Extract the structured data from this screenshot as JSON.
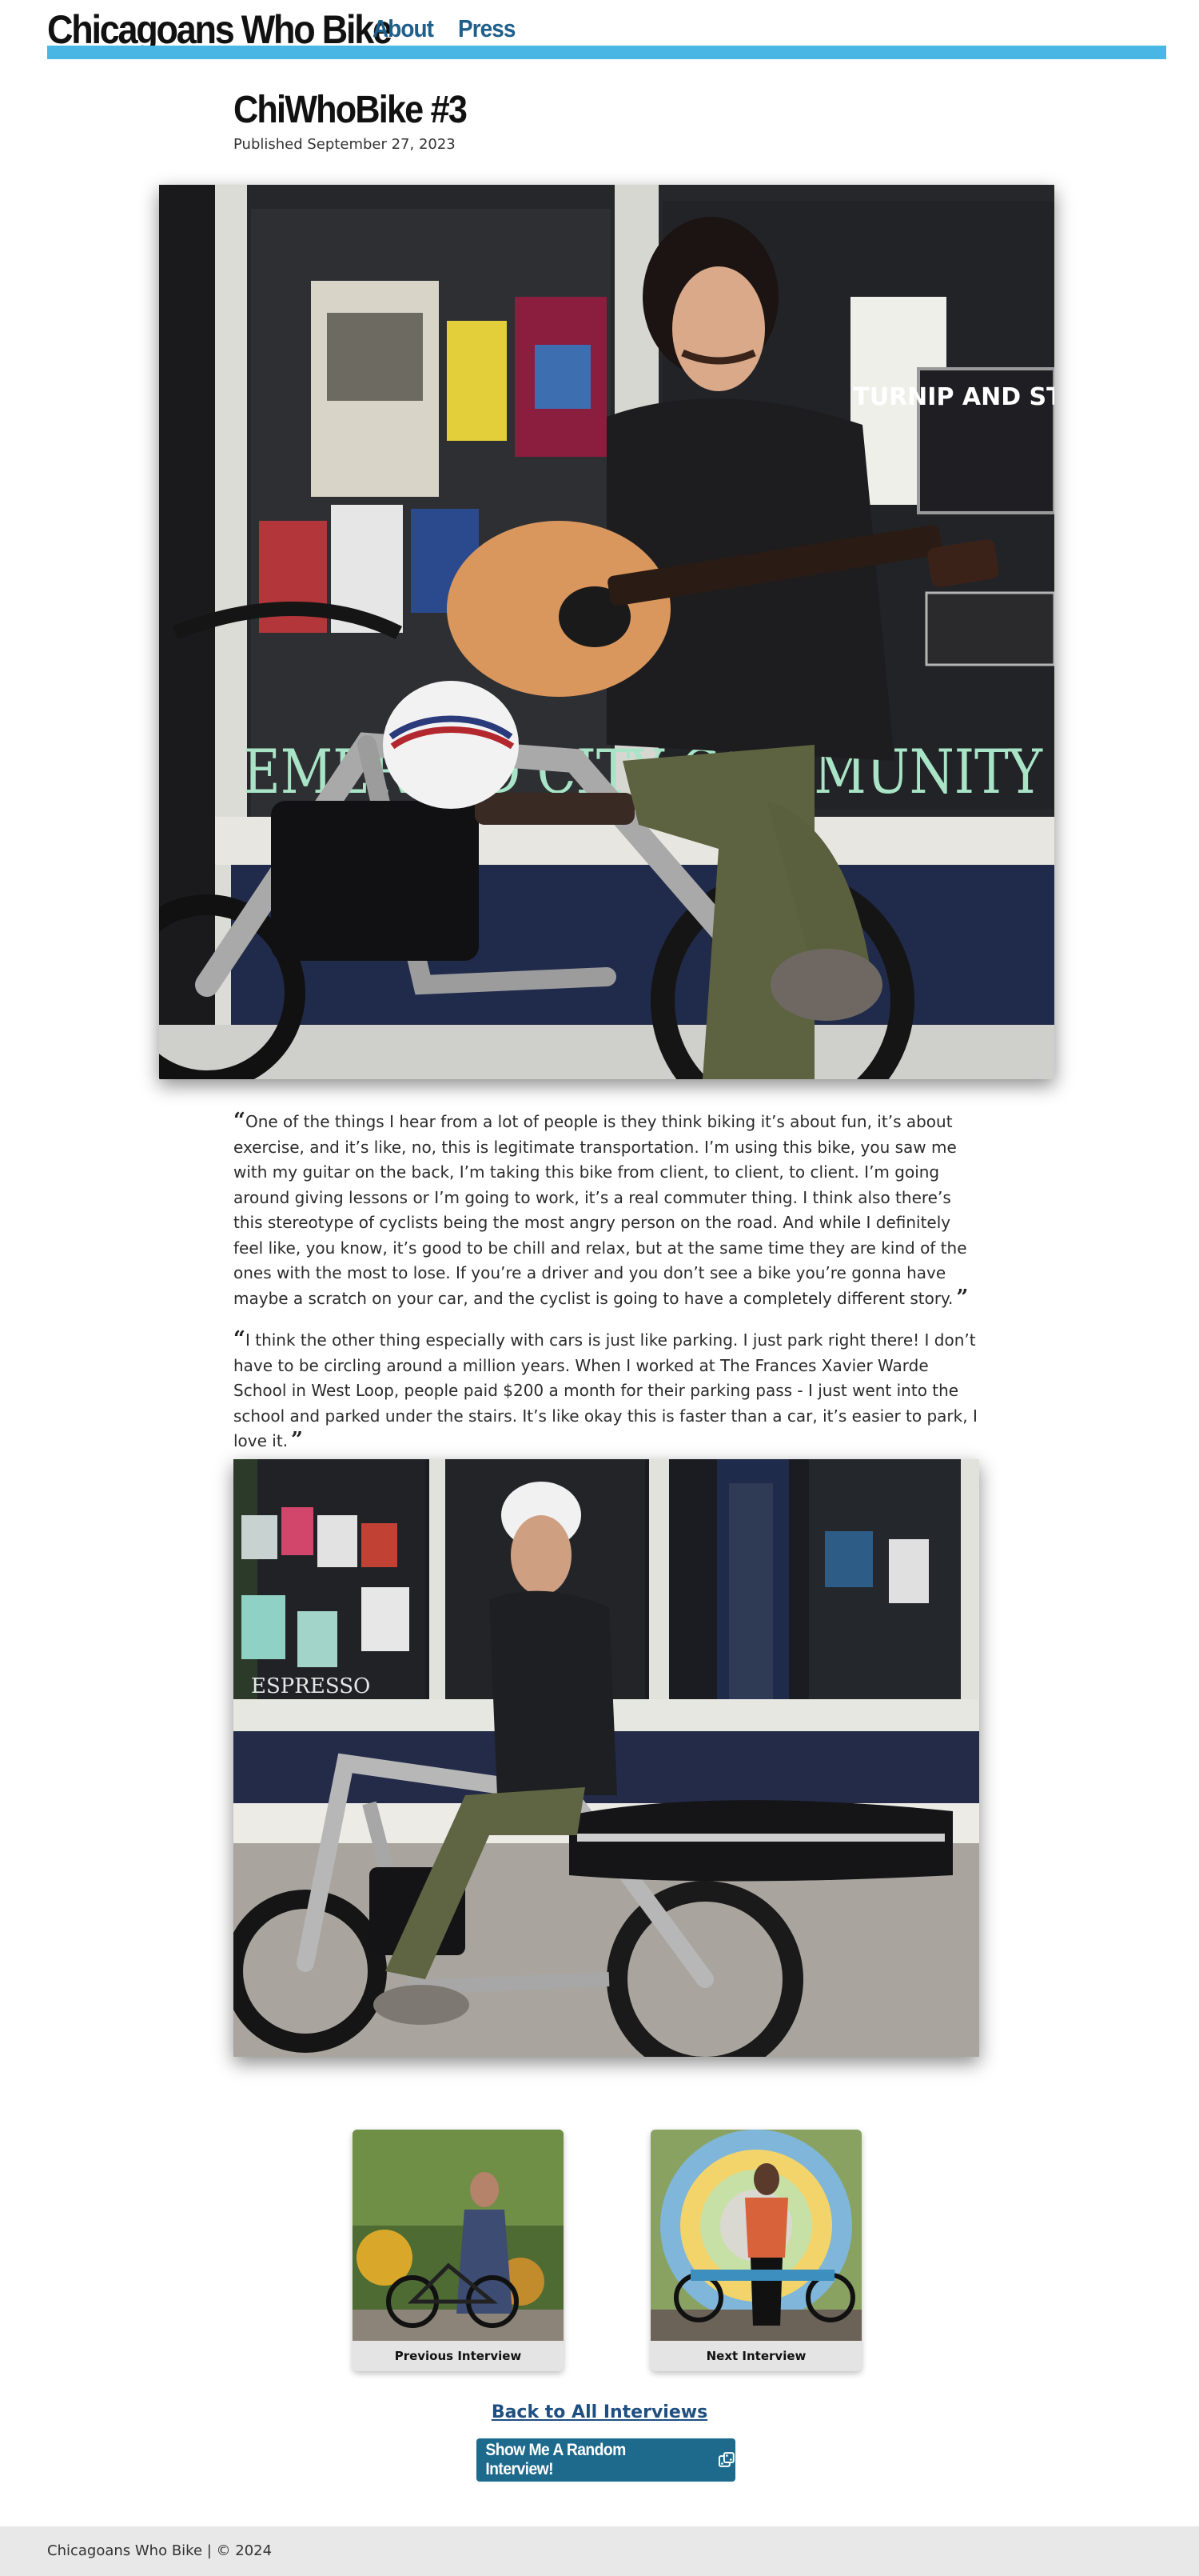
{
  "header": {
    "site_title": "Chicagoans Who Bike",
    "nav": [
      {
        "label": "About"
      },
      {
        "label": "Press"
      }
    ],
    "accent_color": "#49b6e3",
    "link_color": "#1f5f8b"
  },
  "post": {
    "title": "ChiWhoBike #3",
    "published": "Published September 27, 2023",
    "quotes": [
      {
        "open": "“",
        "text": "One of the things I hear from a lot of people is they think biking it’s about fun, it’s about exercise, and it’s like, no, this is legitimate transportation. I’m using this bike, you saw me with my guitar on the back, I’m taking this bike from client, to client, to client. I’m going around giving lessons or I’m going to work, it’s a real commuter thing. I think also there’s this stereotype of cyclists being the most angry person on the road. And while I definitely feel like, you know, it’s good to be chill and relax, but at the same time they are kind of the ones with the most to lose. If you’re a driver and you don’t see a bike you’re gonna have maybe a scratch on your car, and the cyclist is going to have a completely different story.",
        "close": "”"
      },
      {
        "open": "“",
        "text": "I think the other thing especially with cars is just like parking. I just park right there! I don’t have to be circling around a million years. When I worked at The Frances Xavier Warde School in West Loop, people paid $200 a month for their parking pass - I just went into the school and parked under the stairs. It’s like okay this is faster than a car, it’s easier to park, I love it.",
        "close": "”"
      }
    ],
    "photo_sign_text": "EMERALD CITY COMMUNITY",
    "photo_poster_text": "TURNIP AND STONE",
    "photo2_window_text": "ESPRESSO"
  },
  "navigation": {
    "previous_label": "Previous Interview",
    "next_label": "Next Interview",
    "back_link": "Back to All Interviews",
    "random_button": "Show Me A Random Interview!",
    "random_icon": "dice-icon",
    "button_color": "#1d6a8c"
  },
  "footer": {
    "text": "Chicagoans Who Bike | © 2024"
  }
}
